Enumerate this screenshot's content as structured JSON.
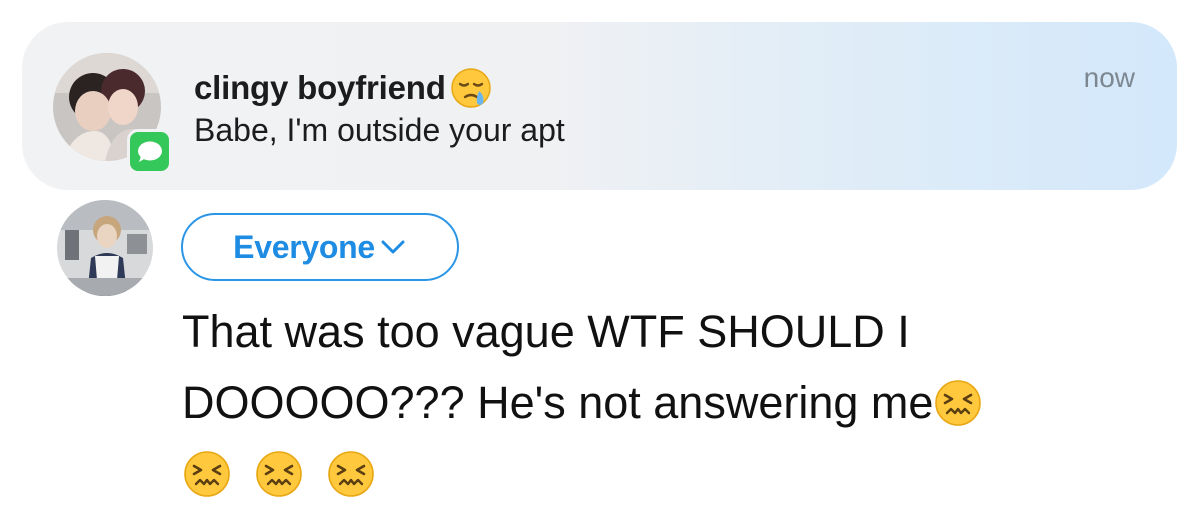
{
  "notification": {
    "sender": "clingy boyfriend",
    "sender_emoji": "drooling-sleepy-face-emoji",
    "message": "Babe, I'm outside your apt",
    "time": "now",
    "app_icon": "messages-icon",
    "colors": {
      "background_left": "#f1f2f4",
      "background_right": "#d3e8fb",
      "app_badge": "#34c759",
      "time_text": "#7d8790"
    }
  },
  "composer": {
    "audience_label": "Everyone",
    "audience_icon": "chevron-down-icon",
    "post_text_line1": "That was too vague WTF SHOULD I",
    "post_text_line2": "DOOOOO??? He's not answering me",
    "emoji": "confounded-face-emoji",
    "emoji_count": 4,
    "colors": {
      "accent": "#1e8ce3",
      "text": "#111111"
    }
  }
}
